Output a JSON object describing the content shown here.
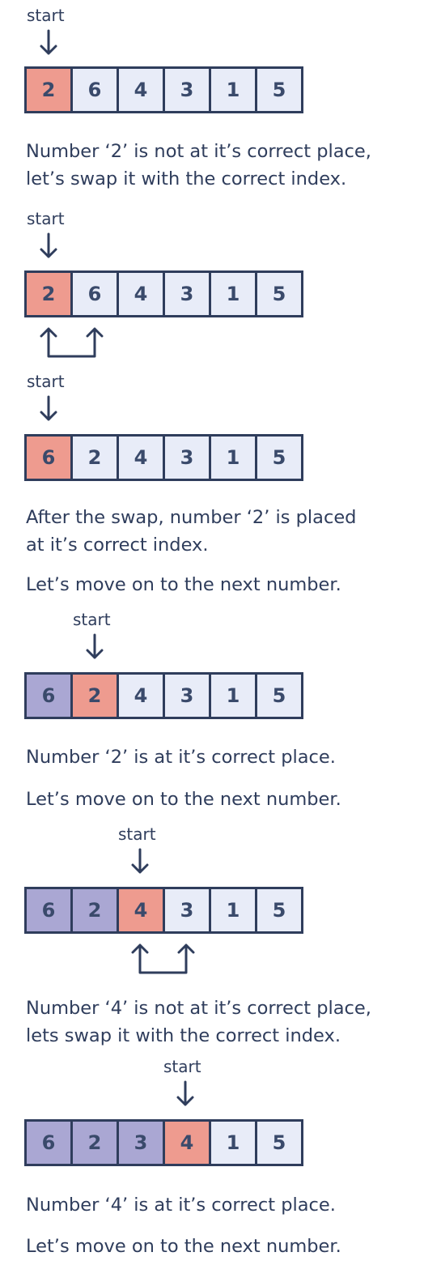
{
  "start_label": "start",
  "arrays": [
    {
      "cells": [
        {
          "v": "2",
          "s": "current"
        },
        {
          "v": "6",
          "s": "normal"
        },
        {
          "v": "4",
          "s": "normal"
        },
        {
          "v": "3",
          "s": "normal"
        },
        {
          "v": "1",
          "s": "normal"
        },
        {
          "v": "5",
          "s": "normal"
        }
      ]
    },
    {
      "cells": [
        {
          "v": "2",
          "s": "current"
        },
        {
          "v": "6",
          "s": "normal"
        },
        {
          "v": "4",
          "s": "normal"
        },
        {
          "v": "3",
          "s": "normal"
        },
        {
          "v": "1",
          "s": "normal"
        },
        {
          "v": "5",
          "s": "normal"
        }
      ]
    },
    {
      "cells": [
        {
          "v": "6",
          "s": "current"
        },
        {
          "v": "2",
          "s": "normal"
        },
        {
          "v": "4",
          "s": "normal"
        },
        {
          "v": "3",
          "s": "normal"
        },
        {
          "v": "1",
          "s": "normal"
        },
        {
          "v": "5",
          "s": "normal"
        }
      ]
    },
    {
      "cells": [
        {
          "v": "6",
          "s": "placed"
        },
        {
          "v": "2",
          "s": "current"
        },
        {
          "v": "4",
          "s": "normal"
        },
        {
          "v": "3",
          "s": "normal"
        },
        {
          "v": "1",
          "s": "normal"
        },
        {
          "v": "5",
          "s": "normal"
        }
      ]
    },
    {
      "cells": [
        {
          "v": "6",
          "s": "placed"
        },
        {
          "v": "2",
          "s": "placed"
        },
        {
          "v": "4",
          "s": "current"
        },
        {
          "v": "3",
          "s": "normal"
        },
        {
          "v": "1",
          "s": "normal"
        },
        {
          "v": "5",
          "s": "normal"
        }
      ]
    },
    {
      "cells": [
        {
          "v": "6",
          "s": "placed"
        },
        {
          "v": "2",
          "s": "placed"
        },
        {
          "v": "3",
          "s": "placed"
        },
        {
          "v": "4",
          "s": "current"
        },
        {
          "v": "1",
          "s": "normal"
        },
        {
          "v": "5",
          "s": "normal"
        }
      ]
    }
  ],
  "texts": {
    "t1": "Number ‘2’ is not at it’s correct place,\nlet’s swap it with the correct index.",
    "t2": "After the swap, number ‘2’ is placed\nat it’s correct index.",
    "t3": "Let’s move on to the next number.",
    "t4": "Number ‘2’ is at it’s correct place.",
    "t5": "Let’s move on to the next number.",
    "t6": "Number ‘4’ is not at it’s correct place,\nlets swap it with the correct index.",
    "t7": "Number ‘4’ is at it’s correct place.",
    "t8": "Let’s move on to the next number."
  },
  "colors": {
    "current": "#ee9b8f",
    "placed": "#aaa7d3",
    "normal": "#e8ecf8",
    "outline": "#2f3d5c"
  }
}
